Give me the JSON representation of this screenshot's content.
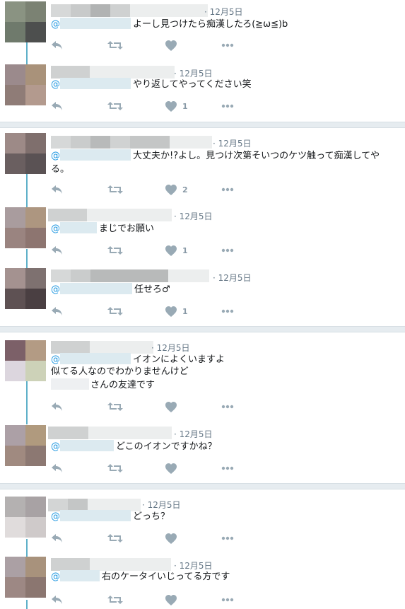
{
  "threads": [
    {
      "tweets": [
        {
          "time": "12月5日",
          "text": "よーし見つけたら痴漢したろ(≧ω≦)b",
          "like_count": ""
        },
        {
          "time": "12月5日",
          "text": "やり返してやってください笑",
          "like_count": "1"
        }
      ]
    },
    {
      "tweets": [
        {
          "time": "12月5日",
          "text_line1": "大丈夫か!?よし。見つけ次第そいつのケツ触って痴漢してや",
          "text_line2": "る。",
          "like_count": "2"
        },
        {
          "time": "12月5日",
          "text": "まじでお願い",
          "like_count": "1"
        },
        {
          "time": "12月5日",
          "text": "任せろ♂",
          "like_count": "1"
        }
      ]
    },
    {
      "tweets": [
        {
          "time": "12月5日",
          "text_line1": "イオンによくいますよ",
          "text_line2": "似てる人なのでわかりませんけど",
          "text_line3": "さんの友達です",
          "like_count": ""
        },
        {
          "time": "12月5日",
          "text": "どこのイオンですかね？",
          "like_count": ""
        }
      ]
    },
    {
      "tweets": [
        {
          "time": "12月5日",
          "text": "どっち？",
          "like_count": ""
        },
        {
          "time": "12月5日",
          "text": "右のケータイいじってる方です",
          "like_count": ""
        }
      ]
    }
  ],
  "mention_prefix": "@",
  "icons": [
    "reply-icon",
    "retweet-icon",
    "like-icon",
    "more-icon"
  ],
  "colors": {
    "thread_line": "#5fb0c9",
    "action_icon": "#99aab5",
    "separator": "#e6ecf0",
    "mention": "#1b95e0"
  }
}
